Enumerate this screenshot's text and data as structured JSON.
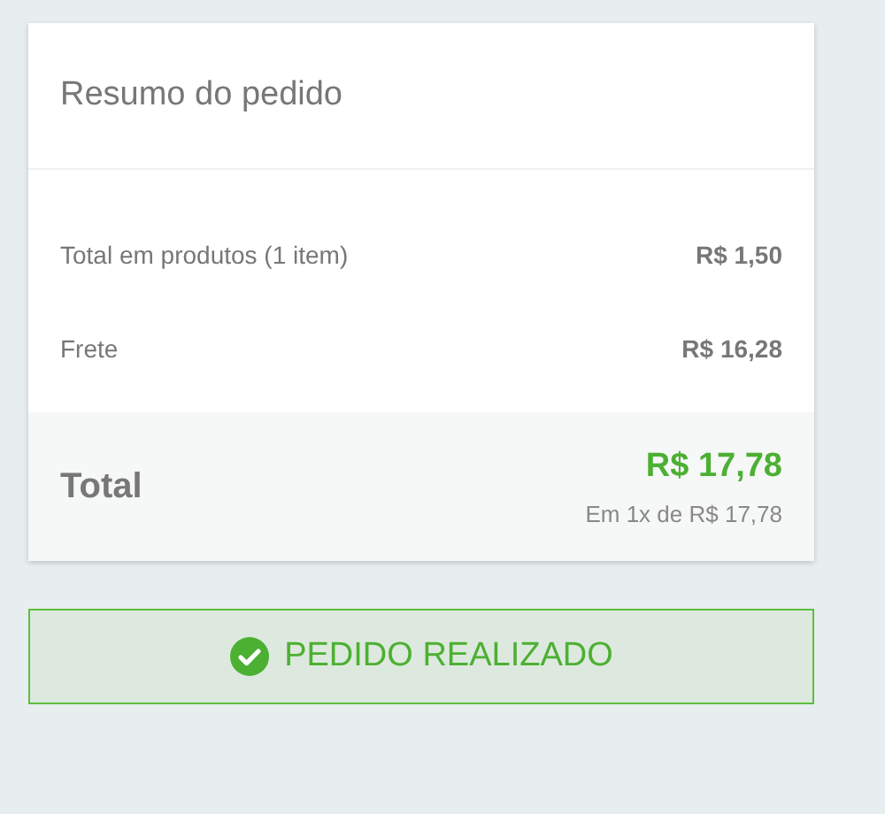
{
  "summary": {
    "title": "Resumo do pedido",
    "rows": [
      {
        "label": "Total em produtos (1 item)",
        "value": "R$ 1,50"
      },
      {
        "label": "Frete",
        "value": "R$ 16,28"
      }
    ],
    "total": {
      "label": "Total",
      "value": "R$ 17,78",
      "installments": "Em 1x de R$ 17,78"
    }
  },
  "status": {
    "label": "PEDIDO REALIZADO"
  }
}
